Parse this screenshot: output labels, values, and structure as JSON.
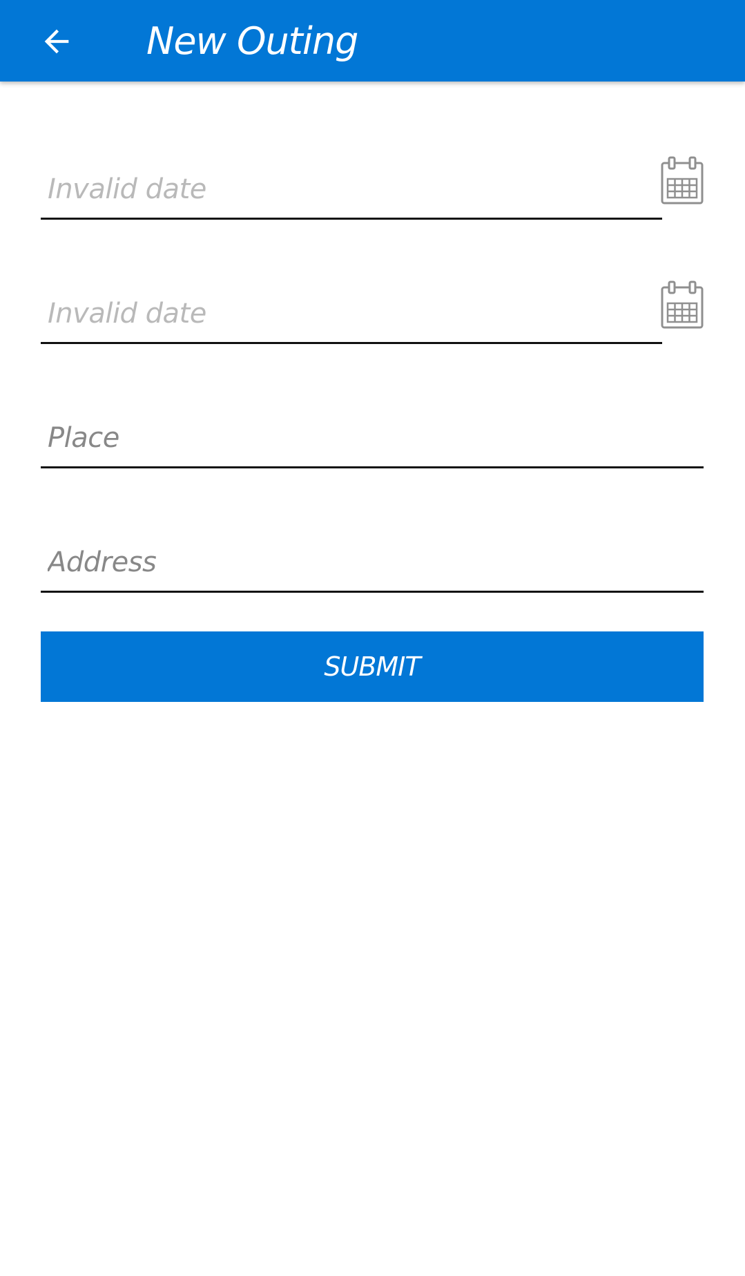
{
  "app_bar": {
    "title": "New Outing",
    "back_icon": "arrow-left-icon",
    "color": "#0277d6"
  },
  "form": {
    "start_date": {
      "placeholder": "Invalid date",
      "icon": "calendar-icon"
    },
    "end_date": {
      "placeholder": "Invalid date",
      "icon": "calendar-icon"
    },
    "place": {
      "placeholder": "Place"
    },
    "address": {
      "placeholder": "Address"
    },
    "submit_label": "SUBMIT"
  }
}
